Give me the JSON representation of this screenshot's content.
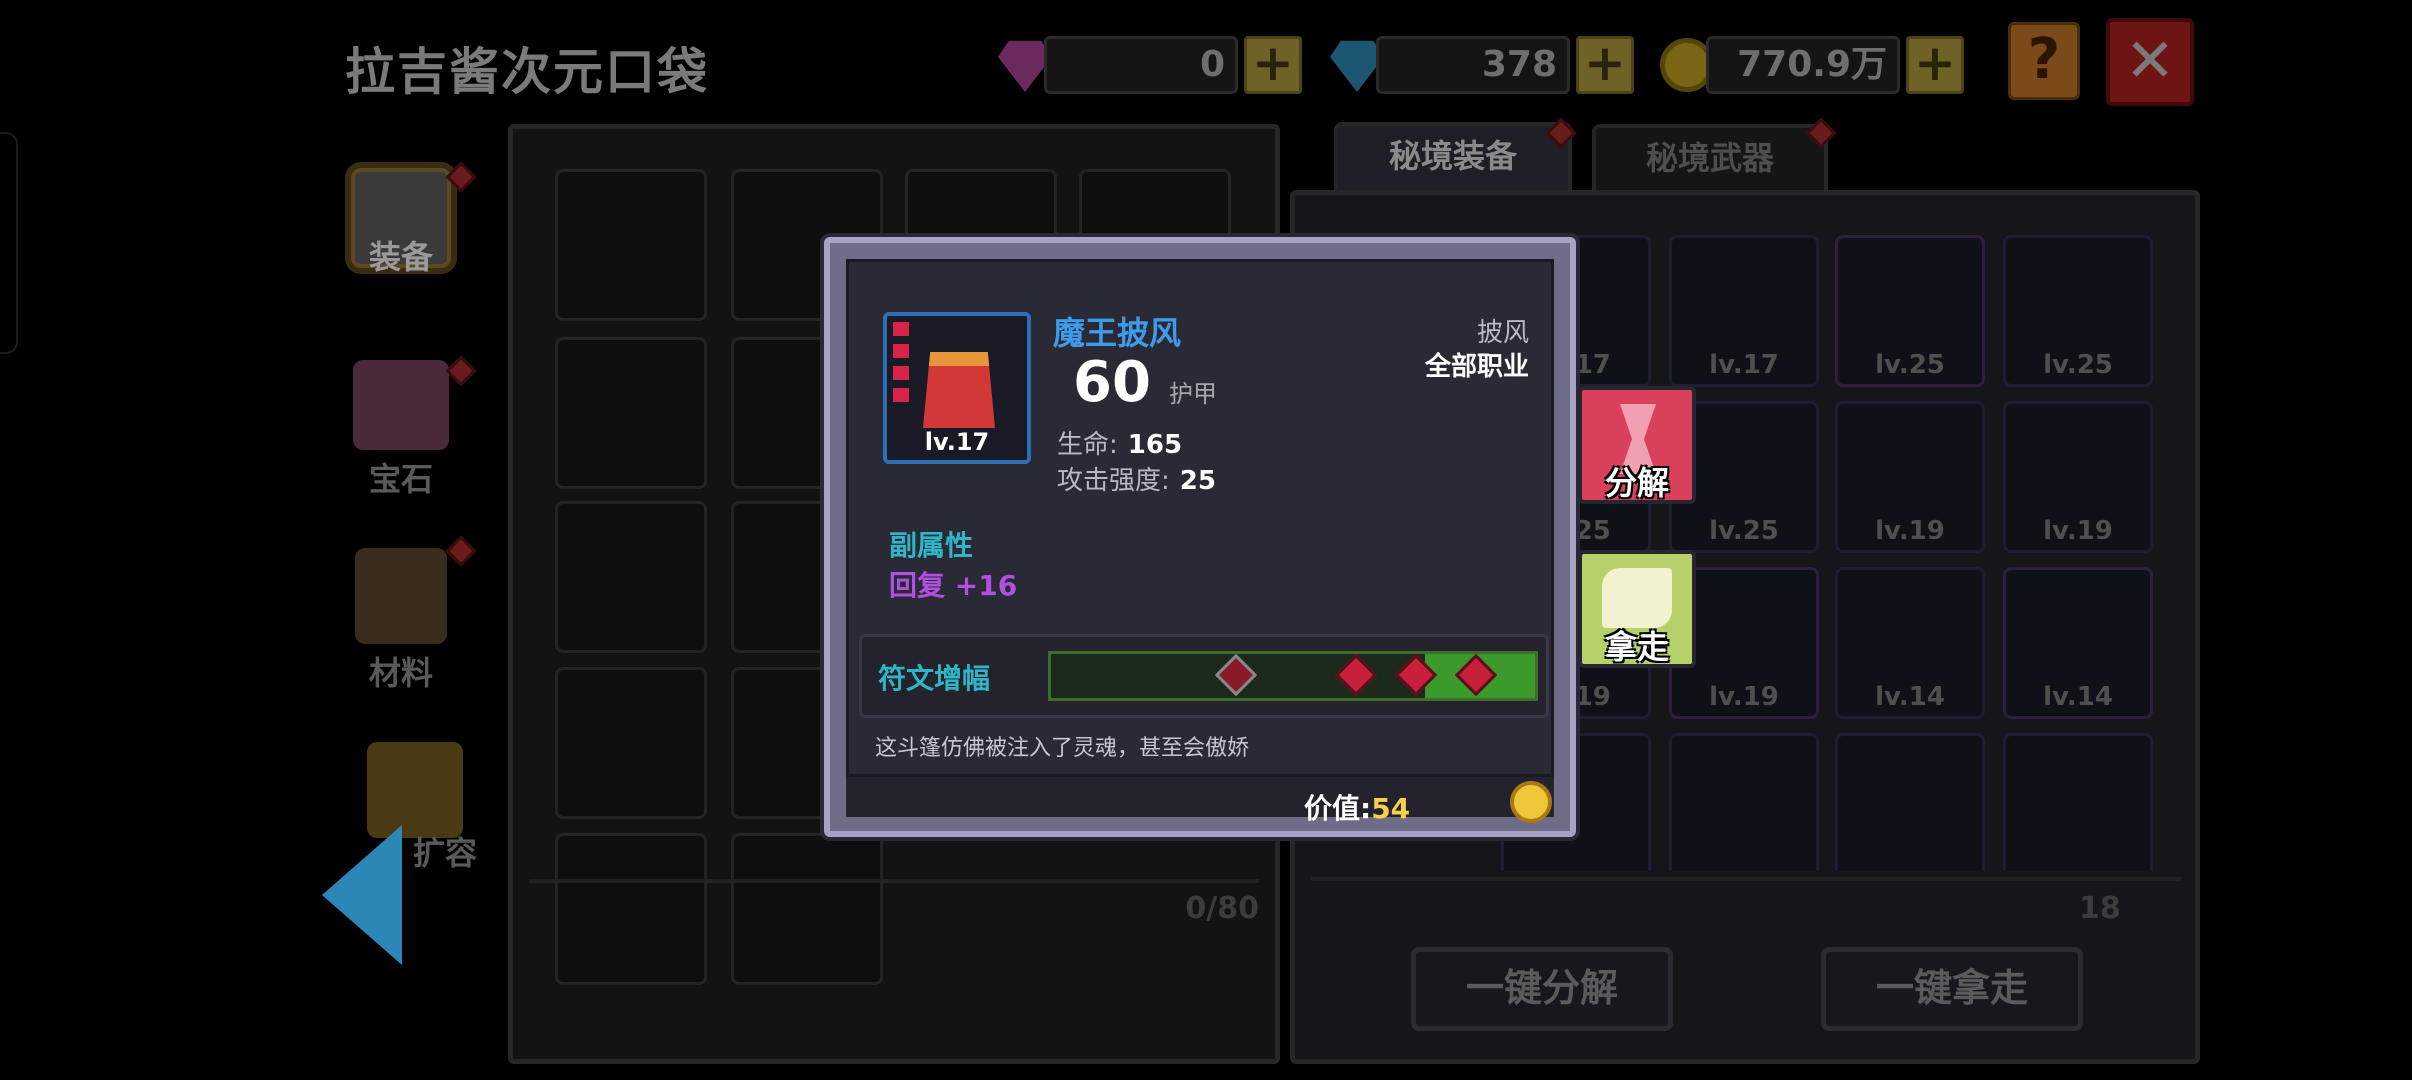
{
  "header": {
    "title": "拉吉酱次元口袋",
    "currencies": [
      {
        "icon": "pink-gem-icon",
        "value": "0"
      },
      {
        "icon": "blue-gem-icon",
        "value": "378"
      },
      {
        "icon": "gold-coin-icon",
        "value": "770.9万"
      }
    ],
    "help_label": "?",
    "close_label": "✕"
  },
  "sidebar": {
    "items": [
      {
        "label": "装备",
        "icon": "armor-icon",
        "active": true
      },
      {
        "label": "宝石",
        "icon": "gem-box-icon",
        "active": false
      },
      {
        "label": "材料",
        "icon": "material-box-icon",
        "active": false
      },
      {
        "label": "扩容",
        "icon": "chest-icon",
        "active": false
      }
    ]
  },
  "left_panel": {
    "count": "0/80"
  },
  "right_panel": {
    "tabs": [
      {
        "label": "秘境装备",
        "active": true
      },
      {
        "label": "秘境武器",
        "active": false
      }
    ],
    "count": "18",
    "slots": [
      {
        "lv": "lv.17"
      },
      {
        "lv": "lv.17"
      },
      {
        "lv": "lv.25"
      },
      {
        "lv": "lv.25"
      },
      {
        "lv": "lv.25"
      },
      {
        "lv": "lv.25"
      },
      {
        "lv": "lv.19"
      },
      {
        "lv": "lv.19"
      },
      {
        "lv": "lv.19"
      },
      {
        "lv": "lv.19"
      },
      {
        "lv": "lv.14"
      },
      {
        "lv": "lv.14"
      }
    ],
    "btn_decompose_all": "一键分解",
    "btn_take_all": "一键拿走"
  },
  "tooltip": {
    "name": "魔王披风",
    "level": "lv.17",
    "power": "60",
    "power_unit": "护甲",
    "stats": [
      {
        "label": "生命:",
        "value": "165"
      },
      {
        "label": "攻击强度:",
        "value": "25"
      }
    ],
    "type": "披风",
    "class": "全部职业",
    "sub_attr_title": "副属性",
    "sub_attr": "回复 +16",
    "rune_label": "符文增幅",
    "flavor": "这斗篷仿佛被注入了灵魂，甚至会傲娇",
    "price_label": "价值:",
    "price_value": "54",
    "name_color": "#3d9be8"
  },
  "actions": {
    "decompose": "分解",
    "take": "拿走"
  }
}
